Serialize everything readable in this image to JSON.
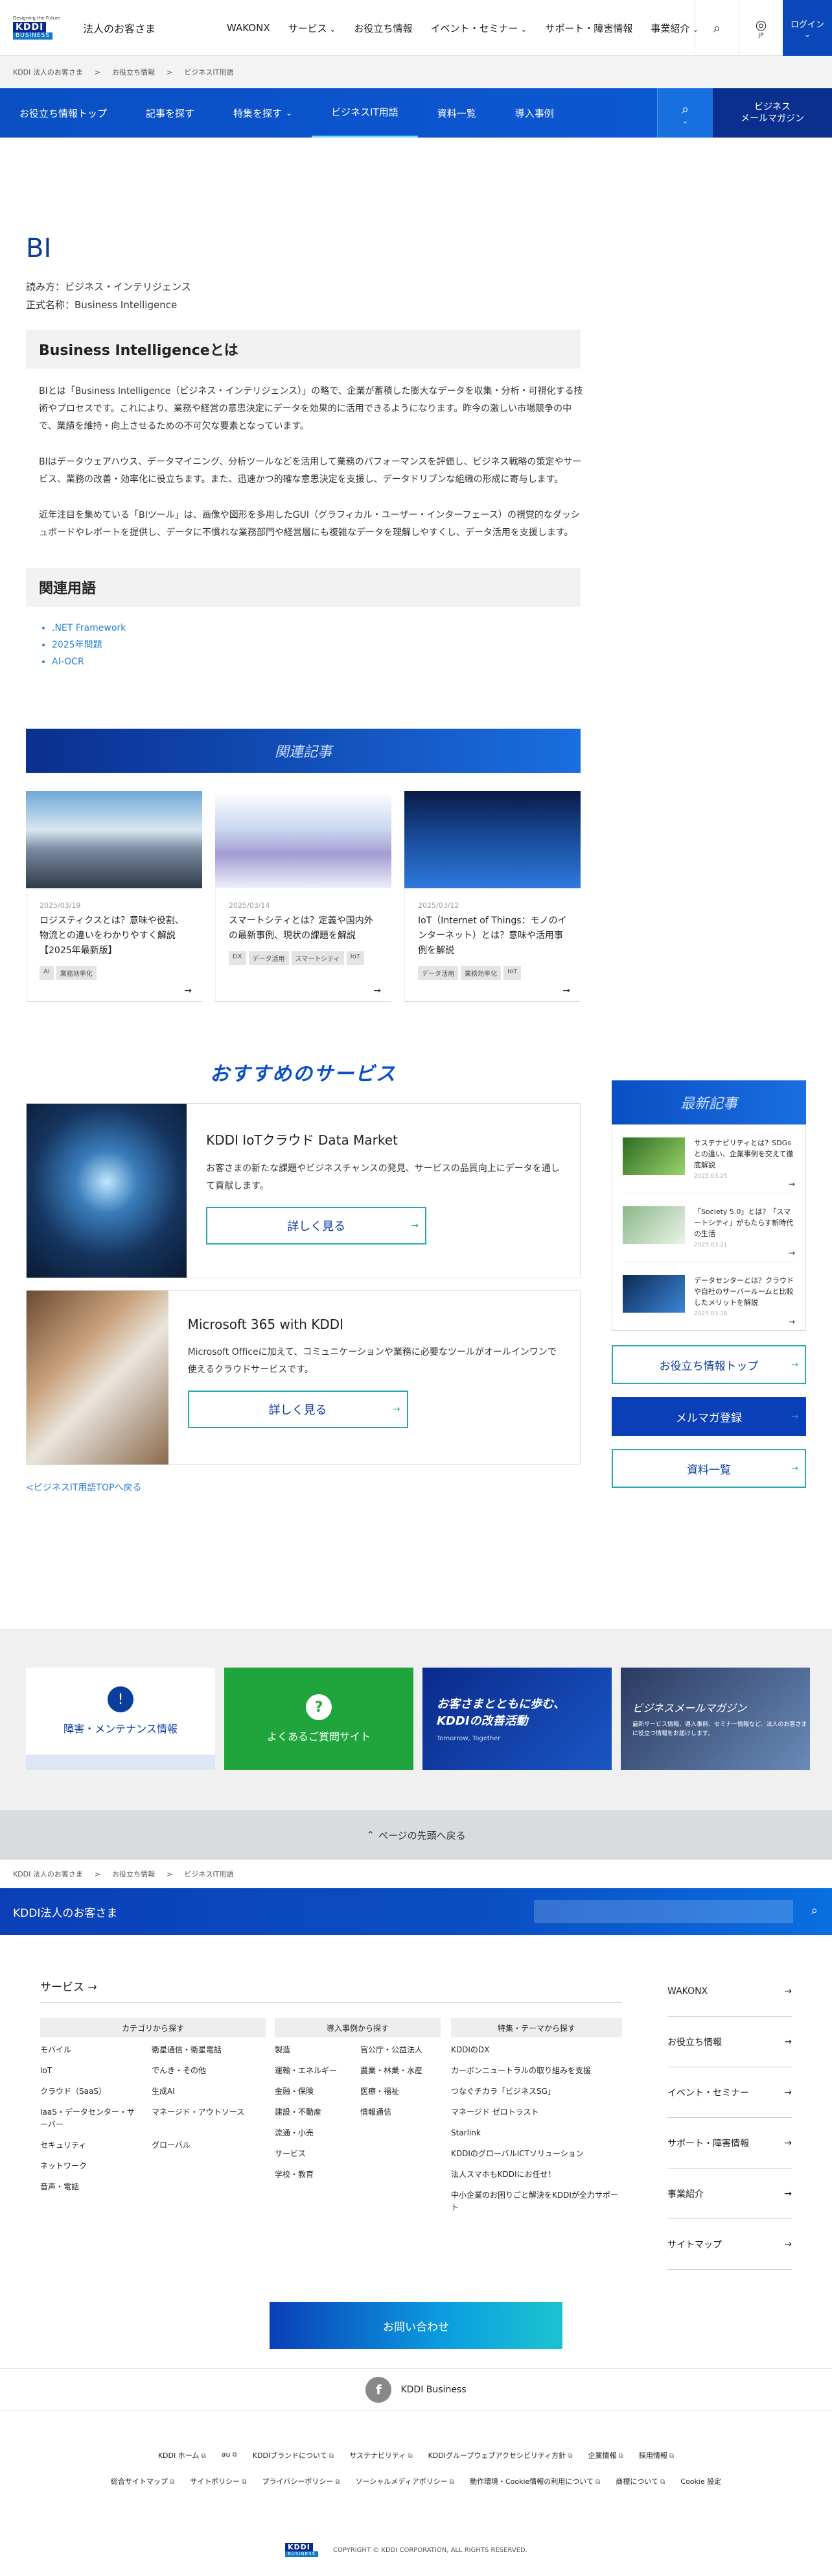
{
  "header": {
    "logo_tag": "Designing the Future",
    "logo_main": "KDDI",
    "logo_sub": "BUSINESS",
    "site_name": "法人のお客さま",
    "nav": [
      "WAKONX",
      "サービス",
      "お役立ち情報",
      "イベント・セミナー",
      "サポート・障害情報",
      "事業紹介"
    ],
    "lang": "JP",
    "login": "ログイン"
  },
  "breadcrumb": [
    "KDDI 法人のお客さま",
    ">",
    "お役立ち情報",
    ">",
    "ビジネスIT用語"
  ],
  "subnav": {
    "items": [
      "お役立ち情報トップ",
      "記事を探す",
      "特集を探す",
      "ビジネスIT用語",
      "資料一覧",
      "導入事例"
    ],
    "magazine_1": "ビジネス",
    "magazine_2": "メールマガジン"
  },
  "term": {
    "title": "BI",
    "reading": "読み方：ビジネス・インテリジェンス",
    "formal": "正式名称：Business Intelligence",
    "section_title": "Business Intelligenceとは",
    "paragraphs": [
      "BIとは「Business Intelligence（ビジネス・インテリジェンス）」の略で、企業が蓄積した膨大なデータを収集・分析・可視化する技術やプロセスです。これにより、業務や経営の意思決定にデータを効果的に活用できるようになります。昨今の激しい市場競争の中で、業績を維持・向上させるための不可欠な要素となっています。",
      "BIはデータウェアハウス、データマイニング、分析ツールなどを活用して業務のパフォーマンスを評価し、ビジネス戦略の策定やサービス、業務の改善・効率化に役立ちます。また、迅速かつ的確な意思決定を支援し、データドリブンな組織の形成に寄与します。",
      "近年注目を集めている「BIツール」は、画像や図形を多用したGUI（グラフィカル・ユーザー・インターフェース）の視覚的なダッシュボードやレポートを提供し、データに不慣れな業務部門や経営層にも複雑なデータを理解しやすくし、データ活用を支援します。"
    ],
    "related_title": "関連用語",
    "related": [
      ".NET Framework",
      "2025年問題",
      "AI-OCR"
    ]
  },
  "related_articles": {
    "title": "関連記事",
    "items": [
      {
        "date": "2025/03/19",
        "title": "ロジスティクスとは？意味や役割、物流との違いをわかりやすく解説【2025年最新版】",
        "tags": [
          "AI",
          "業務効率化"
        ]
      },
      {
        "date": "2025/03/14",
        "title": "スマートシティとは？定義や国内外の最新事例、現状の課題を解説",
        "tags": [
          "DX",
          "データ活用",
          "スマートシティ",
          "IoT"
        ]
      },
      {
        "date": "2025/03/12",
        "title": "IoT（Internet of Things：モノのインターネット）とは？意味や活用事例を解説",
        "tags": [
          "データ活用",
          "業務効率化",
          "IoT"
        ]
      }
    ]
  },
  "recommend": {
    "title": "おすすめのサービス",
    "items": [
      {
        "name": "KDDI IoTクラウド Data Market",
        "desc": "お客さまの新たな課題やビジネスチャンスの発見、サービスの品質向上にデータを通して貢献します。",
        "btn": "詳しく見る"
      },
      {
        "name": "Microsoft 365 with KDDI",
        "desc": "Microsoft Officeに加えて、コミュニケーションや業務に必要なツールがオールインワンで使えるクラウドサービスです。",
        "btn": "詳しく見る"
      }
    ],
    "back": "<ビジネスIT用語TOPへ戻る"
  },
  "sidebar": {
    "title": "最新記事",
    "items": [
      {
        "title": "サステナビリティとは？SDGsとの違い、企業事例を交えて徹底解説",
        "date": "2025.03.25"
      },
      {
        "title": "「Society 5.0」とは？「スマートシティ」がもたらす新時代の生活",
        "date": "2025.03.21"
      },
      {
        "title": "データセンターとは？クラウド や自社のサーバールームと比較したメリットを解説",
        "date": "2025.03.18"
      }
    ],
    "btn_top": "お役立ち情報トップ",
    "btn_mail": "メルマガ登録",
    "btn_docs": "資料一覧"
  },
  "quick_links": {
    "q1": "障害・メンテナンス情報",
    "q2": "よくあるご質問サイト",
    "q3_a": "お客さまとともに歩む、",
    "q3_b": "KDDIの改善活動",
    "q3_c": "Tomorrow, Together",
    "q4_a": "ビジネスメールマガジン",
    "q4_b": "最新サービス情報、導入事例、セミナー情報など、法人のお客さまに役立つ情報をお届けします。"
  },
  "pagetop": "ページの先頭へ戻る",
  "bluebar_title": "KDDI法人のお客さま",
  "footer": {
    "services": "サービス",
    "col1_title": "カテゴリから探す",
    "col1": [
      "モバイル",
      "衛星通信・衛星電話",
      "IoT",
      "でんき・その他",
      "クラウド（SaaS）",
      "生成AI",
      "IaaS・データセンター・サーバー",
      "マネージド・アウトソース",
      "セキュリティ",
      "グローバル",
      "ネットワーク",
      "",
      "音声・電話",
      ""
    ],
    "col2_title": "導入事例から探す",
    "col2": [
      "製造",
      "官公庁・公益法人",
      "運輸・エネルギー",
      "農業・林業・水産",
      "金融・保険",
      "医療・福祉",
      "建設・不動産",
      "情報通信",
      "流通・小売",
      "",
      "サービス",
      "",
      "学校・教育",
      ""
    ],
    "col3_title": "特集・テーマから探す",
    "col3": [
      "KDDIのDX",
      "カーボンニュートラルの取り組みを支援",
      "つなぐチカラ「ビジネスSG」",
      "マネージド ゼロトラスト",
      "Starlink",
      "KDDIのグローバルICTソリューション",
      "法人スマホもKDDIにお任せ！",
      "中小企業のお困りごと解決をKDDIが全力サポート"
    ],
    "right": [
      "WAKONX",
      "お役立ち情報",
      "イベント・セミナー",
      "サポート・障害情報",
      "事業紹介",
      "サイトマップ"
    ],
    "contact": "お問い合わせ",
    "facebook": "KDDI Business",
    "links1": [
      "KDDI ホーム",
      "au",
      "KDDIブランドについて",
      "サステナビリティ",
      "KDDIグループウェブアクセシビリティ方針",
      "企業情報",
      "採用情報"
    ],
    "links2": [
      "総合サイトマップ",
      "サイトポリシー",
      "プライバシーポリシー",
      "ソーシャルメディアポリシー",
      "動作環境・Cookie情報の利用について",
      "商標について",
      "Cookie 設定"
    ],
    "copyright": "COPYRIGHT © KDDI CORPORATION, ALL RIGHTS RESERVED."
  }
}
